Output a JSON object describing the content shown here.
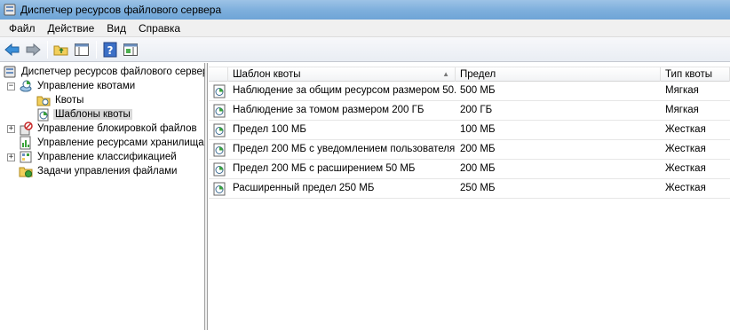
{
  "window": {
    "title": "Диспетчер ресурсов файлового сервера"
  },
  "menu": [
    "Файл",
    "Действие",
    "Вид",
    "Справка"
  ],
  "toolbar": {
    "icons": [
      "back-arrow-icon",
      "forward-arrow-icon",
      "up-folder-icon",
      "show-hide-tree-icon",
      "help-icon",
      "action-pane-icon"
    ]
  },
  "tree": {
    "root": "Диспетчер ресурсов файлового сервер",
    "items": [
      {
        "label": "Управление квотами",
        "expanded": true
      },
      {
        "label": "Квоты"
      },
      {
        "label": "Шаблоны квоты",
        "selected": true
      },
      {
        "label": "Управление блокировкой файлов",
        "expanded": false
      },
      {
        "label": "Управление ресурсами хранилища"
      },
      {
        "label": "Управление классификацией",
        "expanded": false
      },
      {
        "label": "Задачи управления файлами"
      }
    ]
  },
  "list": {
    "columns": [
      "Шаблон квоты",
      "Предел",
      "Тип квоты"
    ],
    "rows": [
      {
        "template": "Наблюдение за общим ресурсом размером 50...",
        "limit": "500 МБ",
        "type": "Мягкая"
      },
      {
        "template": "Наблюдение за томом размером 200 ГБ",
        "limit": "200 ГБ",
        "type": "Мягкая"
      },
      {
        "template": "Предел 100 МБ",
        "limit": "100 МБ",
        "type": "Жесткая"
      },
      {
        "template": "Предел 200 МБ с уведомлением  пользователя",
        "limit": "200 МБ",
        "type": "Жесткая"
      },
      {
        "template": "Предел 200 МБ с расширением 50 МБ",
        "limit": "200 МБ",
        "type": "Жесткая"
      },
      {
        "template": "Расширенный предел 250 МБ",
        "limit": "250 МБ",
        "type": "Жесткая"
      }
    ]
  }
}
